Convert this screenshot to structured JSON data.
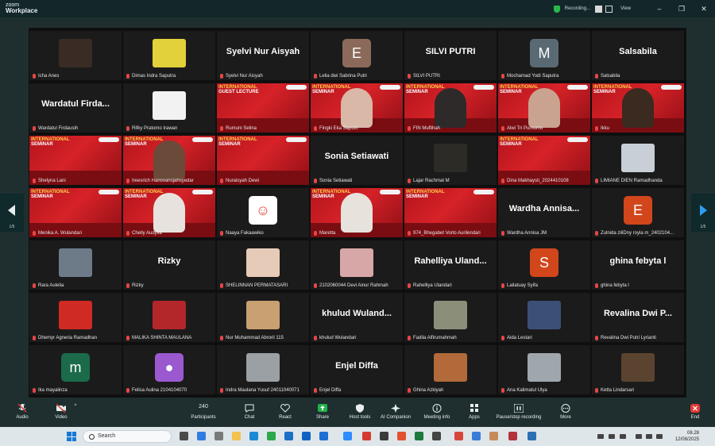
{
  "app": {
    "brand_line1": "zoom",
    "brand_line2": "Workplace"
  },
  "titlebar": {
    "recording": "Recording...",
    "view": "View",
    "minimize": "–",
    "maximize": "❐",
    "close": "✕"
  },
  "page_indicator": {
    "left": "1/5",
    "right": "1/5"
  },
  "tiles": [
    {
      "name": "Icha Anes",
      "type": "photo",
      "color": "#3a2b25"
    },
    {
      "name": "Dimas Indra Saputra",
      "type": "photo",
      "color": "#e2d13a"
    },
    {
      "name": "Syelvi Nur Aisyah",
      "type": "name",
      "big": "Syelvi Nur Aisyah"
    },
    {
      "name": "Lelia dwi Sabrina Putri",
      "type": "avatar",
      "letter": "E",
      "color": "#8b6a5a"
    },
    {
      "name": "SILVI PUTRI",
      "type": "name",
      "big": "SILVI PUTRI"
    },
    {
      "name": "Mochamad Yodi Saputra",
      "type": "avatar",
      "letter": "M",
      "color": "#5a6a74"
    },
    {
      "name": "Salsabila",
      "type": "name",
      "big": "Salsabila"
    },
    {
      "name": "Wardatul Firdausih",
      "type": "name",
      "big": "Wardatul Firda..."
    },
    {
      "name": "Rifky Pratomo Irawan",
      "type": "photo",
      "color": "#f2f2f2"
    },
    {
      "name": "Rumuni Selina",
      "type": "slide",
      "title": "INTERNATIONAL",
      "title2": "GUEST LECTURE"
    },
    {
      "name": "Fingki Eka Saputri",
      "type": "slide",
      "title": "INTERNATIONAL",
      "title2": "SEMINAR",
      "face": "#d9b8a8"
    },
    {
      "name": "FIN Muflihah",
      "type": "slide",
      "title": "INTERNATIONAL",
      "title2": "SEMINAR",
      "face": "#2e2a2a"
    },
    {
      "name": "Alwi Tri Purnomo",
      "type": "slide",
      "title": "INTERNATIONAL",
      "title2": "SEMINAR",
      "face": "#c9a38f"
    },
    {
      "name": "Ikku",
      "type": "slide",
      "title": "INTERNATIONAL",
      "title2": "SEMINAR",
      "face": "#3a2a20"
    },
    {
      "name": "Shelyna Lani",
      "type": "slide",
      "title": "INTERNATIONAL",
      "title2": "SEMINAR"
    },
    {
      "name": "Ireesrich Hanovansjahsyedar",
      "type": "slide",
      "title": "INTERNATIONAL",
      "title2": "SEMINAR",
      "face": "#6b4a3a"
    },
    {
      "name": "Nuraisyah Dewi",
      "type": "slide",
      "title": "INTERNATIONAL",
      "title2": "SEMINAR"
    },
    {
      "name": "Sonia Setiawati",
      "type": "name",
      "big": "Sonia Setiawati"
    },
    {
      "name": "Lajar Rachmat M",
      "type": "photo",
      "color": "#2d2b26"
    },
    {
      "name": "Dina Makhaysti_2024410108",
      "type": "slide",
      "title": "INTERNATIONAL",
      "title2": "SEMINAR"
    },
    {
      "name": "LIMIANE DIEN Ramadhanda",
      "type": "photo",
      "color": "#c9cfd6"
    },
    {
      "name": "Menika A. Wulandari",
      "type": "slide",
      "title": "INTERNATIONAL",
      "title2": "SEMINAR"
    },
    {
      "name": "Chelly Audylia",
      "type": "slide",
      "title": "INTERNATIONAL",
      "title2": "SEMINAR",
      "face": "#e8e2de"
    },
    {
      "name": "Naaya Fakaawiko",
      "type": "avatar",
      "letter": "☺",
      "color": "#ffffff",
      "text": "#e0443a"
    },
    {
      "name": "Maretta",
      "type": "slide",
      "title": "INTERNATIONAL",
      "title2": "SEMINAR",
      "face": "#e7e2dc"
    },
    {
      "name": "974_Bhegabet Vorto Aurilendari",
      "type": "slide",
      "title": "INTERNATIONAL",
      "title2": "SEMINAR"
    },
    {
      "name": "Wardha Annisa JM",
      "type": "name",
      "big": "Wardha Annisa..."
    },
    {
      "name": "Zulnida ziliDny royla m_2402104...",
      "type": "avatar",
      "letter": "E",
      "color": "#d2461c"
    },
    {
      "name": "Rara Aulelia",
      "type": "photo",
      "color": "#6d7b89"
    },
    {
      "name": "Rizky",
      "type": "name",
      "big": "Rizky"
    },
    {
      "name": "SHELINNAN PERMATASARI",
      "type": "photo",
      "color": "#e6cbb8"
    },
    {
      "name": "2102060044 Devi Ainur Rahmah",
      "type": "photo",
      "color": "#d7a6a6"
    },
    {
      "name": "Rahelliya Ulandari",
      "type": "name",
      "big": "Rahelliya Uland..."
    },
    {
      "name": "Lailatuay Syifa",
      "type": "avatar",
      "letter": "S",
      "color": "#d2461c"
    },
    {
      "name": "ghina febyta l",
      "type": "name",
      "big": "ghina febyta l"
    },
    {
      "name": "Dhemyr Agneria Ramadhan",
      "type": "photo",
      "color": "#cf2a24"
    },
    {
      "name": "MALIKA SHINTA MAULANA",
      "type": "photo",
      "color": "#b3262a"
    },
    {
      "name": "Nur Muhammad Abroril 115",
      "type": "photo",
      "color": "#c9a071"
    },
    {
      "name": "khulud Wulandari",
      "type": "name",
      "big": "khulud Wuland..."
    },
    {
      "name": "Fadila Alfirumahmah",
      "type": "photo",
      "color": "#8b8f7a"
    },
    {
      "name": "Aida Lestari",
      "type": "photo",
      "color": "#3c4f77"
    },
    {
      "name": "Revalina Dwi Putri Lyrianti",
      "type": "name",
      "big": "Revalina Dwi P..."
    },
    {
      "name": "Ika mayalinza",
      "type": "avatar",
      "letter": "m",
      "color": "#1b6b4a"
    },
    {
      "name": "Felisa Aulina 2104104070",
      "type": "avatar",
      "letter": "●",
      "color": "#9b59d0"
    },
    {
      "name": "Indra Maulana Yusuf 24011040071",
      "type": "photo",
      "color": "#9aa0a4"
    },
    {
      "name": "Enjel Diffa",
      "type": "name",
      "big": "Enjel Diffa"
    },
    {
      "name": "Ghina Azkiyah",
      "type": "photo",
      "color": "#b26a3a"
    },
    {
      "name": "Ana Kalimatul Ulya",
      "type": "photo",
      "color": "#9fa7ac"
    },
    {
      "name": "Ketta Lindarsari",
      "type": "photo",
      "color": "#5a4430"
    }
  ],
  "toolbar": {
    "audio": "Audio",
    "video": "Video",
    "participants": "Participants",
    "participants_count": "240",
    "chat": "Chat",
    "react": "React",
    "share": "Share",
    "host_tools": "Host tools",
    "ai_companion": "AI Companion",
    "meeting_info": "Meeting info",
    "apps": "Apps",
    "pause_recording": "Pause/stop recording",
    "more": "More",
    "end": "End"
  },
  "taskbar": {
    "search": "Search",
    "time": "08.28",
    "date": "12/08/2025"
  },
  "colors": {
    "accent": "#1679d6",
    "end": "#e53935",
    "share": "#21b24b"
  }
}
